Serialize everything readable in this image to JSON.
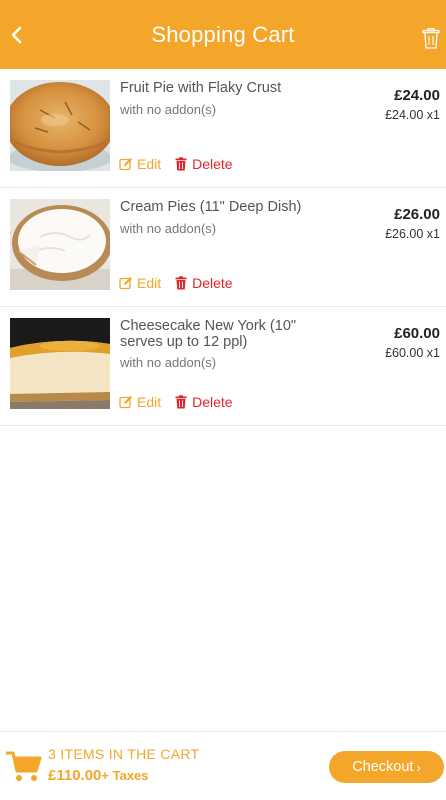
{
  "header": {
    "title": "Shopping Cart",
    "back_icon": "chevron-left-icon",
    "trash_icon": "trash-icon"
  },
  "items": [
    {
      "name": "Fruit Pie with Flaky Crust",
      "addon": "with no addon(s)",
      "price": "£24.00",
      "unit": "£24.00 x1",
      "edit": "Edit",
      "delete": "Delete"
    },
    {
      "name": "Cream Pies (11\" Deep Dish)",
      "addon": "with no addon(s)",
      "price": "£26.00",
      "unit": "£26.00 x1",
      "edit": "Edit",
      "delete": "Delete"
    },
    {
      "name": "Cheesecake New York (10\" serves up to 12 ppl)",
      "addon": "with no addon(s)",
      "price": "£60.00",
      "unit": "£60.00 x1",
      "edit": "Edit",
      "delete": "Delete"
    }
  ],
  "footer": {
    "count_text": "3 ITEMS IN THE CART",
    "total": "£110.00",
    "taxes": "+ Taxes",
    "checkout": "Checkout",
    "checkout_chevron": "›"
  },
  "colors": {
    "accent": "#f4a62a",
    "danger": "#e0262d"
  }
}
